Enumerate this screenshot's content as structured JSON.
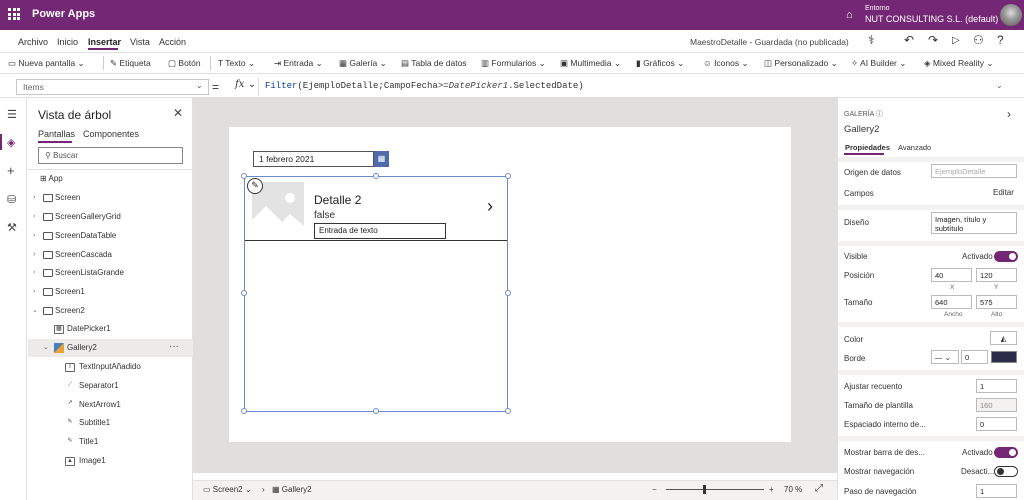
{
  "app": {
    "title": "Power Apps",
    "env_label": "Entorno",
    "env_name": "NUT CONSULTING S.L. (default)"
  },
  "menu": {
    "items": [
      "Archivo",
      "Inicio",
      "Insertar",
      "Vista",
      "Acción"
    ],
    "active": "Insertar",
    "doc_title": "MaestroDetalle - Guardada (no publicada)"
  },
  "ribbon": {
    "items": [
      {
        "label": "Nueva pantalla",
        "icon": "new-screen-icon",
        "dropdown": true
      },
      {
        "label": "Etiqueta",
        "icon": "label-icon",
        "dropdown": false
      },
      {
        "label": "Botón",
        "icon": "button-icon",
        "dropdown": false
      },
      {
        "label": "Texto",
        "icon": "text-icon",
        "dropdown": true
      },
      {
        "label": "Entrada",
        "icon": "input-icon",
        "dropdown": true
      },
      {
        "label": "Galería",
        "icon": "gallery-icon",
        "dropdown": true
      },
      {
        "label": "Tabla de datos",
        "icon": "data-table-icon",
        "dropdown": false
      },
      {
        "label": "Formularios",
        "icon": "forms-icon",
        "dropdown": true
      },
      {
        "label": "Multimedia",
        "icon": "media-icon",
        "dropdown": true
      },
      {
        "label": "Gráficos",
        "icon": "charts-icon",
        "dropdown": true
      },
      {
        "label": "Iconos",
        "icon": "icons-icon",
        "dropdown": true
      },
      {
        "label": "Personalizado",
        "icon": "custom-icon",
        "dropdown": true
      },
      {
        "label": "AI Builder",
        "icon": "ai-builder-icon",
        "dropdown": true
      },
      {
        "label": "Mixed Reality",
        "icon": "mixed-reality-icon",
        "dropdown": true
      }
    ]
  },
  "formula_bar": {
    "property": "Items",
    "eq": "=",
    "fx": "fx",
    "fn": "Filter",
    "args": "(EjemploDetalle;CampoFecha>=",
    "ref": "DatePicker1",
    "tail": ".SelectedDate)"
  },
  "tree": {
    "title": "Vista de árbol",
    "tabs": [
      "Pantallas",
      "Componentes"
    ],
    "search_placeholder": "Buscar",
    "app": "App",
    "screens": [
      "Screen",
      "ScreenGalleryGrid",
      "ScreenDataTable",
      "ScreenCascada",
      "ScreenListaGrande",
      "Screen1",
      "Screen2"
    ],
    "screen2_children": {
      "datepicker": "DatePicker1",
      "gallery": "Gallery2",
      "gallery_children": [
        "TextInputAñadido",
        "Separator1",
        "NextArrow1",
        "Subtitle1",
        "Title1",
        "Image1"
      ]
    },
    "more": "···"
  },
  "canvas": {
    "date_value": "1 febrero 2021",
    "item_title": "Detalle 2",
    "item_subtitle": "false",
    "text_input": "Entrada de texto"
  },
  "status": {
    "screen": "Screen2",
    "control": "Gallery2",
    "zoom": "70",
    "zoom_unit": "%",
    "zoom_level": 0.35
  },
  "props": {
    "section": "GALERÍA",
    "name": "Gallery2",
    "tabs": [
      "Propiedades",
      "Avanzado"
    ],
    "data_source_label": "Origen de datos",
    "data_source": "EjemploDetalle",
    "fields_label": "Campos",
    "fields_action": "Editar",
    "layout_label": "Diseño",
    "layout_value": "Imagen, título y subtítulo",
    "visible_label": "Visible",
    "visible_state": "Activado",
    "position_label": "Posición",
    "x": "40",
    "y": "120",
    "x_lbl": "X",
    "y_lbl": "Y",
    "size_label": "Tamaño",
    "width": "640",
    "height": "575",
    "w_lbl": "Ancho",
    "h_lbl": "Alto",
    "color_label": "Color",
    "border_label": "Borde",
    "border_width": "0",
    "border_color": "#2b2b4a",
    "wrap_label": "Ajustar recuento",
    "wrap_value": "1",
    "template_label": "Tamaño de plantilla",
    "template_value": "160",
    "padding_label": "Espaciado interno de...",
    "padding_value": "0",
    "scrollbar_label": "Mostrar barra de des...",
    "scrollbar_state": "Activado",
    "nav_label": "Mostrar navegación",
    "nav_state": "Desacti...",
    "navstep_label": "Paso de navegación",
    "navstep_value": "1"
  },
  "colors": {
    "brand": "#742774",
    "canvas_bg": "#e1dfdd",
    "selection": "#6b8bd0",
    "datepicker_btn": "#4f6bab"
  }
}
